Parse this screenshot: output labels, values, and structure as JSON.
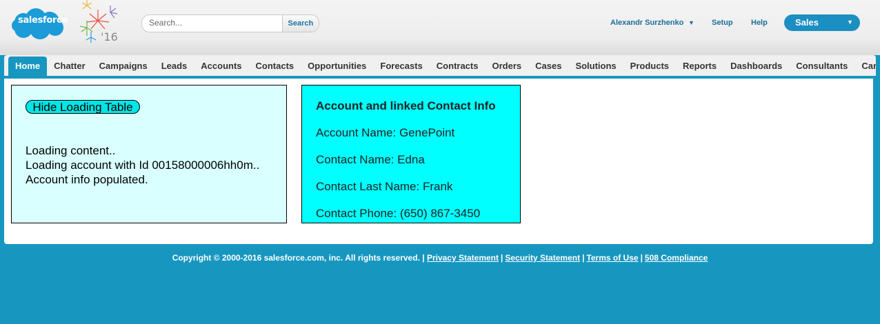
{
  "header": {
    "logo_text": "salesforce",
    "year_badge": "'16",
    "search": {
      "placeholder": "Search...",
      "value": "",
      "button_label": "Search"
    },
    "user_menu_label": "Alexandr Surzhenko",
    "setup_label": "Setup",
    "help_label": "Help",
    "app_picker_label": "Sales"
  },
  "colors": {
    "brand": "#1797c0",
    "logo": "#1b9bd7",
    "loading_panel": "#d9ffff",
    "info_panel": "#00ffff"
  },
  "tabs": [
    {
      "label": "Home",
      "active": true
    },
    {
      "label": "Chatter"
    },
    {
      "label": "Campaigns"
    },
    {
      "label": "Leads"
    },
    {
      "label": "Accounts"
    },
    {
      "label": "Contacts"
    },
    {
      "label": "Opportunities"
    },
    {
      "label": "Forecasts"
    },
    {
      "label": "Contracts"
    },
    {
      "label": "Orders"
    },
    {
      "label": "Cases"
    },
    {
      "label": "Solutions"
    },
    {
      "label": "Products"
    },
    {
      "label": "Reports"
    },
    {
      "label": "Dashboards"
    },
    {
      "label": "Consultants"
    },
    {
      "label": "Candid"
    }
  ],
  "loading_panel": {
    "hide_button_label": "Hide Loading Table",
    "lines": [
      "Loading content..",
      "Loading account with Id 00158000006hh0m..",
      "Account info populated."
    ]
  },
  "info_panel": {
    "title": "Account and linked Contact Info",
    "account_name": "Account Name: GenePoint",
    "contact_name": "Contact Name: Edna",
    "contact_last_name": "Contact Last Name: Frank",
    "contact_phone": "Contact Phone: (650) 867-3450"
  },
  "footer": {
    "copyright": "Copyright © 2000-2016 salesforce.com, inc. All rights reserved. |",
    "links": [
      "Privacy Statement",
      "Security Statement",
      "Terms of Use",
      "508 Compliance"
    ]
  }
}
